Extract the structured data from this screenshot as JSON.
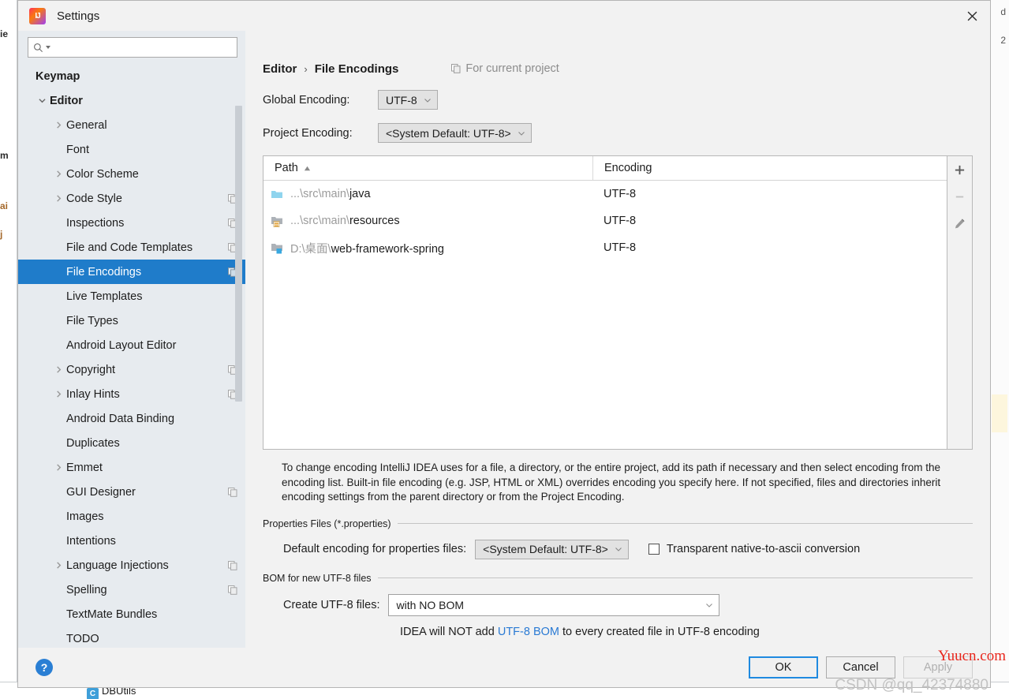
{
  "window": {
    "title": "Settings",
    "app_icon": "intellij-idea-icon",
    "close_icon": "close-icon"
  },
  "search": {
    "value": "",
    "placeholder": "",
    "icon": "search-icon"
  },
  "sidebar": {
    "scrollbar": "vertical-scrollbar",
    "help_label": "?",
    "items": [
      {
        "label": "Keymap",
        "indent": 0,
        "bold": true,
        "arrow": "none",
        "copy": false,
        "selected": false
      },
      {
        "label": "Editor",
        "indent": 0,
        "bold": true,
        "arrow": "down",
        "copy": false,
        "selected": false
      },
      {
        "label": "General",
        "indent": 1,
        "bold": false,
        "arrow": "right",
        "copy": false,
        "selected": false
      },
      {
        "label": "Font",
        "indent": 1,
        "bold": false,
        "arrow": "none",
        "copy": false,
        "selected": false
      },
      {
        "label": "Color Scheme",
        "indent": 1,
        "bold": false,
        "arrow": "right",
        "copy": false,
        "selected": false
      },
      {
        "label": "Code Style",
        "indent": 1,
        "bold": false,
        "arrow": "right",
        "copy": true,
        "selected": false
      },
      {
        "label": "Inspections",
        "indent": 1,
        "bold": false,
        "arrow": "none",
        "copy": true,
        "selected": false
      },
      {
        "label": "File and Code Templates",
        "indent": 1,
        "bold": false,
        "arrow": "none",
        "copy": true,
        "selected": false
      },
      {
        "label": "File Encodings",
        "indent": 1,
        "bold": false,
        "arrow": "none",
        "copy": true,
        "selected": true
      },
      {
        "label": "Live Templates",
        "indent": 1,
        "bold": false,
        "arrow": "none",
        "copy": false,
        "selected": false
      },
      {
        "label": "File Types",
        "indent": 1,
        "bold": false,
        "arrow": "none",
        "copy": false,
        "selected": false
      },
      {
        "label": "Android Layout Editor",
        "indent": 1,
        "bold": false,
        "arrow": "none",
        "copy": false,
        "selected": false
      },
      {
        "label": "Copyright",
        "indent": 1,
        "bold": false,
        "arrow": "right",
        "copy": true,
        "selected": false
      },
      {
        "label": "Inlay Hints",
        "indent": 1,
        "bold": false,
        "arrow": "right",
        "copy": true,
        "selected": false
      },
      {
        "label": "Android Data Binding",
        "indent": 1,
        "bold": false,
        "arrow": "none",
        "copy": false,
        "selected": false
      },
      {
        "label": "Duplicates",
        "indent": 1,
        "bold": false,
        "arrow": "none",
        "copy": false,
        "selected": false
      },
      {
        "label": "Emmet",
        "indent": 1,
        "bold": false,
        "arrow": "right",
        "copy": false,
        "selected": false
      },
      {
        "label": "GUI Designer",
        "indent": 1,
        "bold": false,
        "arrow": "none",
        "copy": true,
        "selected": false
      },
      {
        "label": "Images",
        "indent": 1,
        "bold": false,
        "arrow": "none",
        "copy": false,
        "selected": false
      },
      {
        "label": "Intentions",
        "indent": 1,
        "bold": false,
        "arrow": "none",
        "copy": false,
        "selected": false
      },
      {
        "label": "Language Injections",
        "indent": 1,
        "bold": false,
        "arrow": "right",
        "copy": true,
        "selected": false
      },
      {
        "label": "Spelling",
        "indent": 1,
        "bold": false,
        "arrow": "none",
        "copy": true,
        "selected": false
      },
      {
        "label": "TextMate Bundles",
        "indent": 1,
        "bold": false,
        "arrow": "none",
        "copy": false,
        "selected": false
      },
      {
        "label": "TODO",
        "indent": 1,
        "bold": false,
        "arrow": "none",
        "copy": false,
        "selected": false
      }
    ]
  },
  "content": {
    "breadcrumb": {
      "parent": "Editor",
      "separator": "›",
      "current": "File Encodings"
    },
    "scope": {
      "icon": "copy-icon",
      "label": "For current project"
    },
    "global_encoding": {
      "label": "Global Encoding:",
      "value": "UTF-8"
    },
    "project_encoding": {
      "label": "Project Encoding:",
      "value": "<System Default: UTF-8>"
    },
    "table": {
      "columns": [
        "Path",
        "Encoding"
      ],
      "sort_column": "Path",
      "sort_direction": "asc",
      "rows": [
        {
          "icon": "folder-blue-icon",
          "path_prefix": "...\\src\\main\\",
          "path_name": "java",
          "encoding": "UTF-8"
        },
        {
          "icon": "folder-resources-icon",
          "path_prefix": "...\\src\\main\\",
          "path_name": "resources",
          "encoding": "UTF-8"
        },
        {
          "icon": "folder-module-icon",
          "path_prefix": "D:\\桌面\\",
          "path_name": "web-framework-spring",
          "encoding": "UTF-8"
        }
      ]
    },
    "table_toolbar": [
      {
        "name": "add-button",
        "icon": "plus-icon",
        "enabled": true
      },
      {
        "name": "remove-button",
        "icon": "minus-icon",
        "enabled": false
      },
      {
        "name": "edit-button",
        "icon": "pencil-icon",
        "enabled": true
      }
    ],
    "hint": "To change encoding IntelliJ IDEA uses for a file, a directory, or the entire project, add its path if necessary and then select encoding from the encoding list. Built-in file encoding (e.g. JSP, HTML or XML) overrides encoding you specify here. If not specified, files and directories inherit encoding settings from the parent directory or from the Project Encoding.",
    "properties_group": {
      "title": "Properties Files (*.properties)",
      "default_encoding_label": "Default encoding for properties files:",
      "default_encoding_value": "<System Default: UTF-8>",
      "transparent_label": "Transparent native-to-ascii conversion",
      "transparent_checked": false
    },
    "bom_group": {
      "title": "BOM for new UTF-8 files",
      "create_label": "Create UTF-8 files:",
      "create_value": "with NO BOM",
      "note_before": "IDEA will NOT add ",
      "note_link": "UTF-8 BOM",
      "note_after": " to every created file in UTF-8 encoding"
    }
  },
  "footer": {
    "ok": "OK",
    "cancel": "Cancel",
    "apply": "Apply"
  },
  "watermarks": {
    "red": "Yuucn.com",
    "grey": "CSDN @qq_42374880"
  },
  "background": {
    "left_fragments": [
      "ie",
      "m",
      "ai",
      "j"
    ],
    "right_fragments": [
      "d",
      "2"
    ],
    "bottom_item": "DBUtils",
    "bottom_item_badge": "C"
  },
  "colors": {
    "accent": "#1f7cca",
    "selection": "#1f7cca",
    "link": "#2a7ad4",
    "watermark_red": "#e8261c",
    "dialog_bg": "#f2f2f2",
    "sidebar_bg": "#e7ebef"
  }
}
